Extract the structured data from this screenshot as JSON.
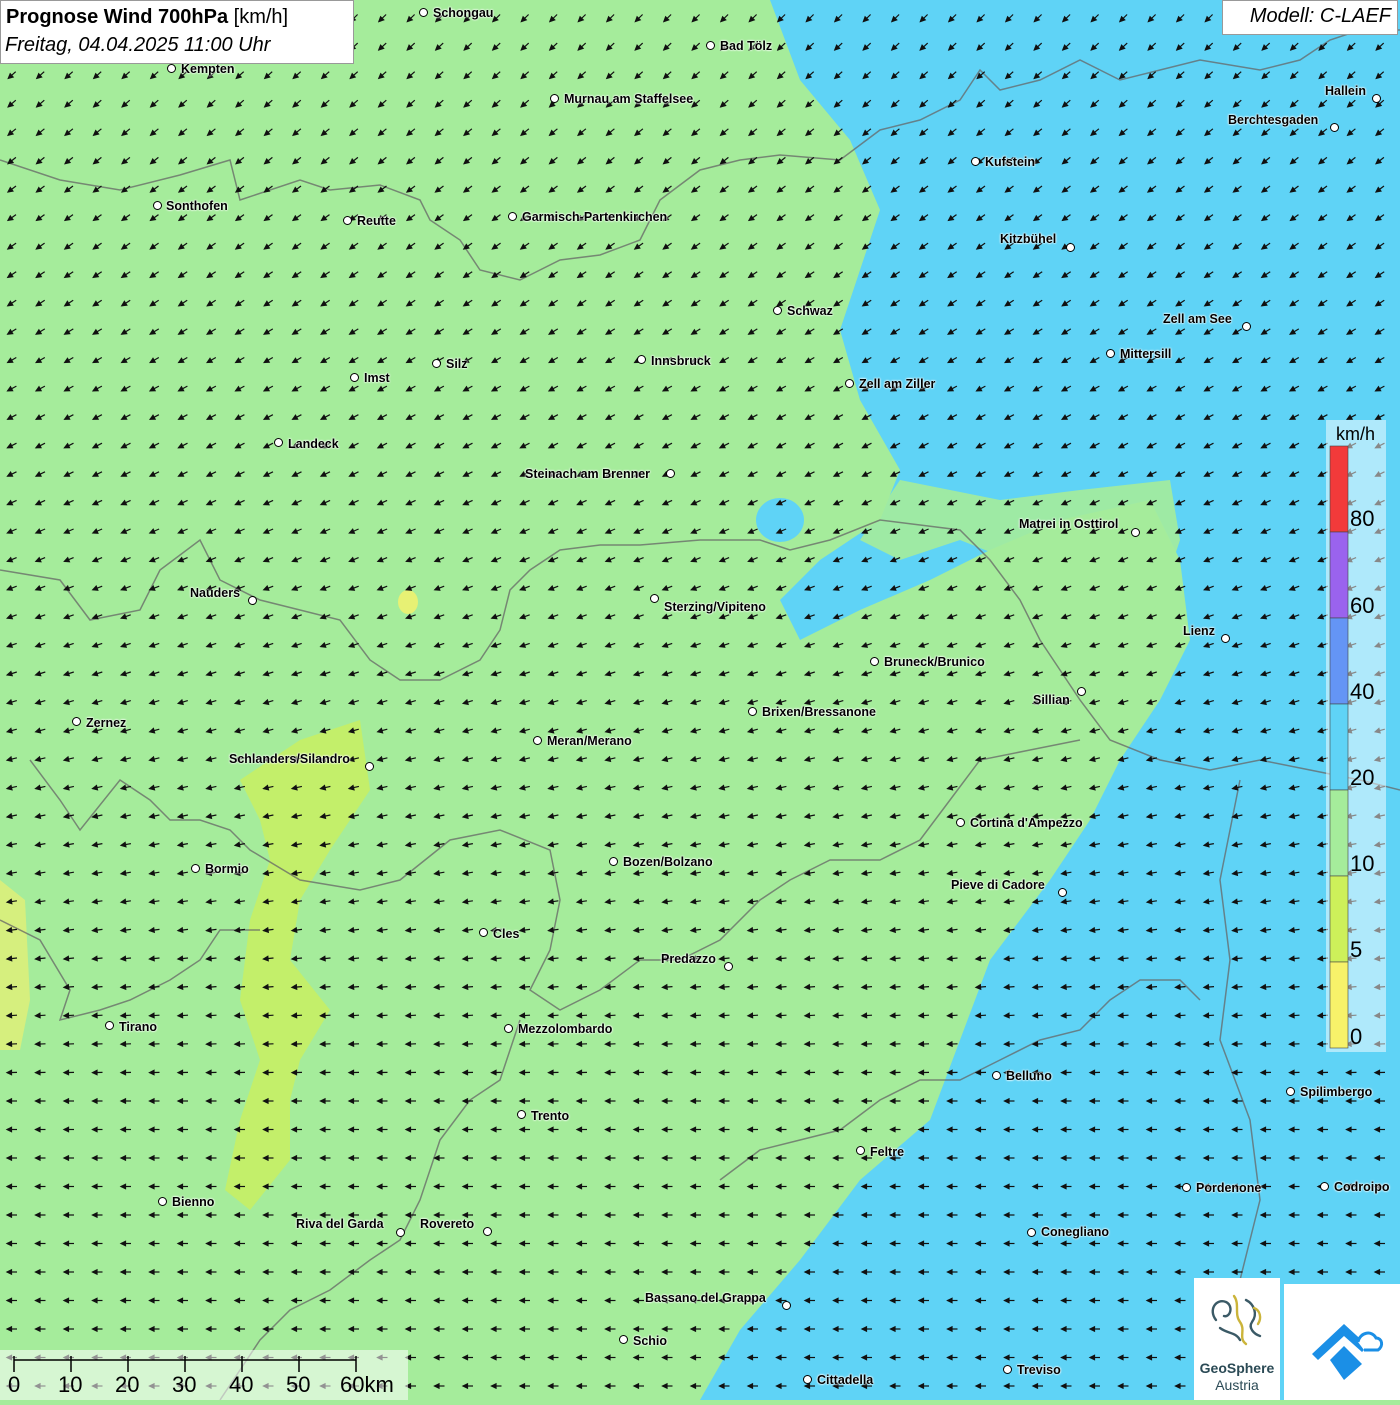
{
  "header": {
    "title_bold": "Prognose Wind 700hPa",
    "title_unit": " [km/h]",
    "date": "Freitag, 04.04.2025 11:00 Uhr",
    "model": "Modell: C-LAEF"
  },
  "legend": {
    "unit": "km/h",
    "labels": [
      "80",
      "60",
      "40",
      "20",
      "10",
      "5",
      "0"
    ],
    "colors": {
      "band_0_5": "#f7f26a",
      "band_5_10": "#cdf05a",
      "band_10_20": "#a5ec9b",
      "band_20_40": "#5fd3f6",
      "band_40_60": "#6495f5",
      "band_60_80": "#9a63ee",
      "band_80_plus": "#f23a3a"
    }
  },
  "scale": {
    "labels": [
      "0",
      "10",
      "20",
      "30",
      "40",
      "50",
      "60km"
    ]
  },
  "cities": [
    {
      "name": "Schongau"
    },
    {
      "name": "Bad Tölz"
    },
    {
      "name": "Kempten"
    },
    {
      "name": "Murnau am Staffelsee"
    },
    {
      "name": "Hallein"
    },
    {
      "name": "Berchtesgaden"
    },
    {
      "name": "Kufstein"
    },
    {
      "name": "Sonthofen"
    },
    {
      "name": "Reutte"
    },
    {
      "name": "Garmisch-Partenkirchen"
    },
    {
      "name": "Kitzbühel"
    },
    {
      "name": "Schwaz"
    },
    {
      "name": "Zell am See"
    },
    {
      "name": "Innsbruck"
    },
    {
      "name": "Silz"
    },
    {
      "name": "Imst"
    },
    {
      "name": "Mittersill"
    },
    {
      "name": "Zell am Ziller"
    },
    {
      "name": "Landeck"
    },
    {
      "name": "Steinach am Brenner"
    },
    {
      "name": "Matrei in Osttirol"
    },
    {
      "name": "Nauders"
    },
    {
      "name": "Sterzing/Vipiteno"
    },
    {
      "name": "Lienz"
    },
    {
      "name": "Bruneck/Brunico"
    },
    {
      "name": "Sillian"
    },
    {
      "name": "Brixen/Bressanone"
    },
    {
      "name": "Zernez"
    },
    {
      "name": "Meran/Merano"
    },
    {
      "name": "Schlanders/Silandro"
    },
    {
      "name": "Cortina d'Ampezzo"
    },
    {
      "name": "Bozen/Bolzano"
    },
    {
      "name": "Bormio"
    },
    {
      "name": "Pieve di Cadore"
    },
    {
      "name": "Cles"
    },
    {
      "name": "Predazzo"
    },
    {
      "name": "Tirano"
    },
    {
      "name": "Mezzolombardo"
    },
    {
      "name": "Belluno"
    },
    {
      "name": "Spilimbergo"
    },
    {
      "name": "Trento"
    },
    {
      "name": "Feltre"
    },
    {
      "name": "Pordenone"
    },
    {
      "name": "Codroipo"
    },
    {
      "name": "Bienno"
    },
    {
      "name": "Riva del Garda"
    },
    {
      "name": "Rovereto"
    },
    {
      "name": "Conegliano"
    },
    {
      "name": "Bassano del Grappa"
    },
    {
      "name": "Schio"
    },
    {
      "name": "Treviso"
    },
    {
      "name": "Cittadella"
    }
  ],
  "logo": {
    "name": "GeoSphere",
    "subname": "Austria"
  }
}
